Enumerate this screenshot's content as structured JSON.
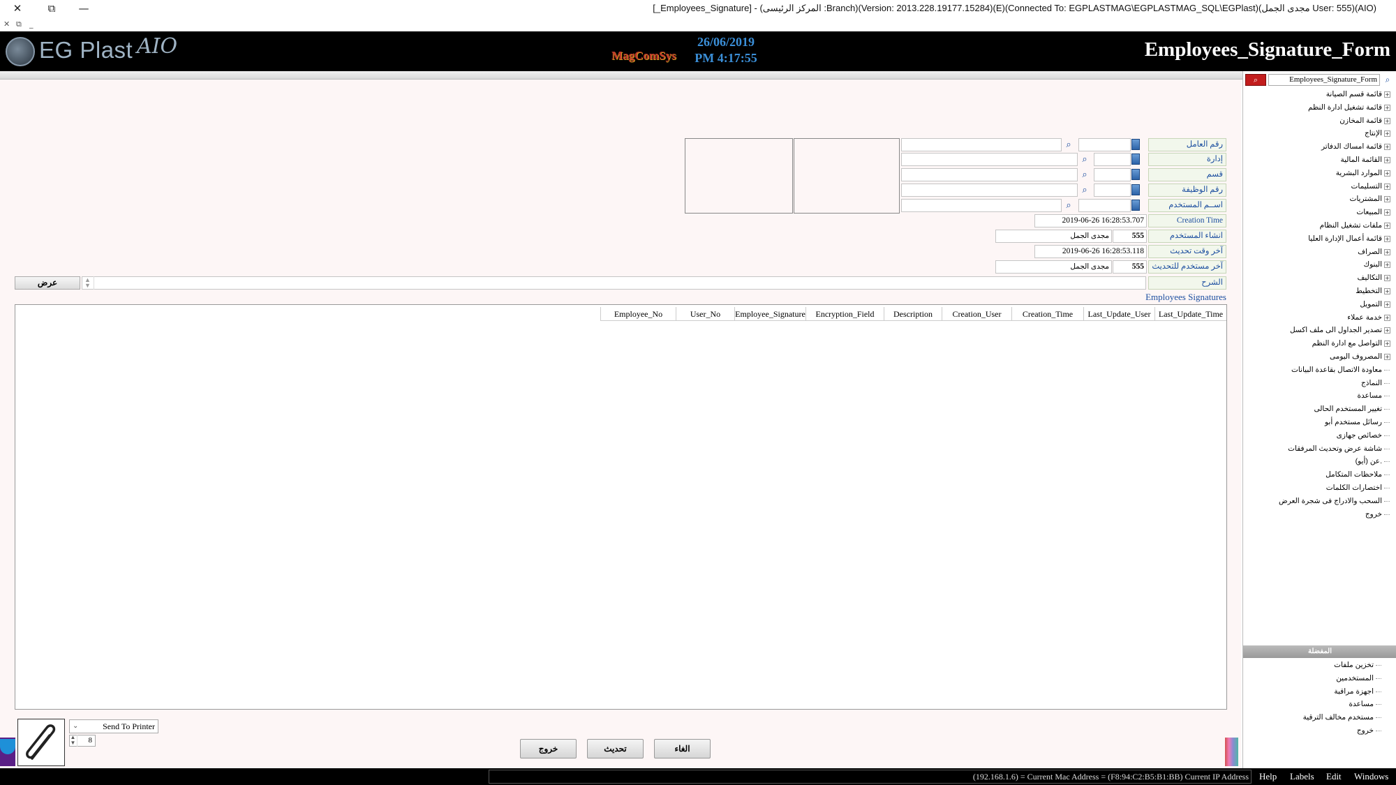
{
  "window": {
    "title": "[_Employees_Signature] - (المركز الرئيسى :Branch)(Version: 2013.228.19177.15284)(E)(Connected To: EGPLASTMAG\\EGPLASTMAG_SQL\\EGPlast)(مجدى الجمل User: 555)(AIO)",
    "close_glyph": "✕",
    "restore_glyph": "⧉",
    "minimize_glyph": "—",
    "mini_close": "✕",
    "mini_restore": "⧉",
    "mini_minimize": "_"
  },
  "header": {
    "logo_text": "EG Plast",
    "logo_suffix": "AIO",
    "partner_logo": "MagComSys",
    "date": "26/06/2019",
    "time": "PM 4:17:55",
    "form_name": "Employees_Signature_Form"
  },
  "form": {
    "fields": {
      "employee_no": {
        "label": "رقم العامل",
        "value": "",
        "name_value": ""
      },
      "department": {
        "label": "إدارة",
        "value": "",
        "name_value": ""
      },
      "section": {
        "label": "قسم",
        "value": "",
        "name_value": ""
      },
      "job_no": {
        "label": "رقم الوظيفة",
        "value": "",
        "name_value": ""
      },
      "user_name": {
        "label": "اســم المستخدم",
        "value": "",
        "name_value": ""
      },
      "creation_time": {
        "label": "Creation Time",
        "value": "2019-06-26 16:28:53.707"
      },
      "creation_user": {
        "label": "انشاء المستخدم",
        "code": "555",
        "name": "مجدى الجمل"
      },
      "last_update_time": {
        "label": "آخر وقت تحديث",
        "value": "2019-06-26 16:28:53.118"
      },
      "last_update_user": {
        "label": "آخر مستخدم للتحديث",
        "code": "555",
        "name": "مجدى الجمل"
      },
      "notes": {
        "label": "الشرح",
        "value": ""
      }
    },
    "show_button": "عرض",
    "section_title": "Employees Signatures",
    "grid_columns": [
      "Employee_No",
      "User_No",
      "Employee_Signature",
      "Encryption_Field",
      "Description",
      "Creation_User",
      "Creation_Time",
      "Last_Update_User",
      "Last_Update_Time"
    ],
    "buttons": {
      "cancel": "الغاء",
      "update": "تحديث",
      "exit": "خروج"
    },
    "printer": {
      "selected": "Send To Printer",
      "copies": "8"
    }
  },
  "nav": {
    "search_value": "Employees_Signature_Form",
    "tree": [
      {
        "label": "قائمة قسم الصيانة",
        "expandable": true
      },
      {
        "label": "قائمة تشغيل ادارة النظم",
        "expandable": true
      },
      {
        "label": "قائمة المخازن",
        "expandable": true
      },
      {
        "label": "الإنتاج",
        "expandable": true
      },
      {
        "label": "قائمة امساك الدفاتر",
        "expandable": true
      },
      {
        "label": "القائمة المالية",
        "expandable": true
      },
      {
        "label": "الموارد البشرية",
        "expandable": true
      },
      {
        "label": "التسليمات",
        "expandable": true
      },
      {
        "label": "المشتريات",
        "expandable": true
      },
      {
        "label": "المبيعات",
        "expandable": true
      },
      {
        "label": "ملفات تشغيل النظام",
        "expandable": true
      },
      {
        "label": "قائمة أعمال الإدارة العليا",
        "expandable": true
      },
      {
        "label": "الصراف",
        "expandable": true
      },
      {
        "label": "البنوك",
        "expandable": true
      },
      {
        "label": "التكاليف",
        "expandable": true
      },
      {
        "label": "التخطيط",
        "expandable": true
      },
      {
        "label": "التمويل",
        "expandable": true
      },
      {
        "label": "خدمة عملاء",
        "expandable": true
      },
      {
        "label": "تصدير الجداول الى ملف اكسل",
        "expandable": true
      },
      {
        "label": "التواصل مع ادارة النظم",
        "expandable": true
      },
      {
        "label": "المصروف اليومى",
        "expandable": true
      },
      {
        "label": "معاودة الاتصال بقاعدة البيانات",
        "expandable": false
      },
      {
        "label": "النماذج",
        "expandable": false
      },
      {
        "label": "مساعدة",
        "expandable": false
      },
      {
        "label": "تغيير المستخدم الحالى",
        "expandable": false
      },
      {
        "label": "رسائل مستخدم أبو",
        "expandable": false
      },
      {
        "label": "خصائص جهازى",
        "expandable": false
      },
      {
        "label": "شاشة عرض وتحديث المرفقات",
        "expandable": false
      },
      {
        "label": "عن (أيو).",
        "expandable": false
      },
      {
        "label": "ملاحظات المتكامل",
        "expandable": false
      },
      {
        "label": "اختصارات الكلمات",
        "expandable": false
      },
      {
        "label": "السحب والادراج فى شجرة العرض",
        "expandable": false
      },
      {
        "label": "خروج",
        "expandable": false
      }
    ],
    "section_label": "المفضلة",
    "tree2": [
      {
        "label": "تخزين ملفات"
      },
      {
        "label": "المستخدمين"
      },
      {
        "label": "اجهزة مراقبة"
      },
      {
        "label": "مساعدة"
      },
      {
        "label": "مستخدم مخالف الترقية"
      },
      {
        "label": "خروج"
      }
    ]
  },
  "statusbar": {
    "ip_text": "(192.168.1.6) = Current Mac Address = (F8:94:C2:B5:B1:BB) Current IP Address",
    "menus": {
      "help": "Help",
      "labels": "Labels",
      "edit": "Edit",
      "windows": "Windows"
    }
  }
}
